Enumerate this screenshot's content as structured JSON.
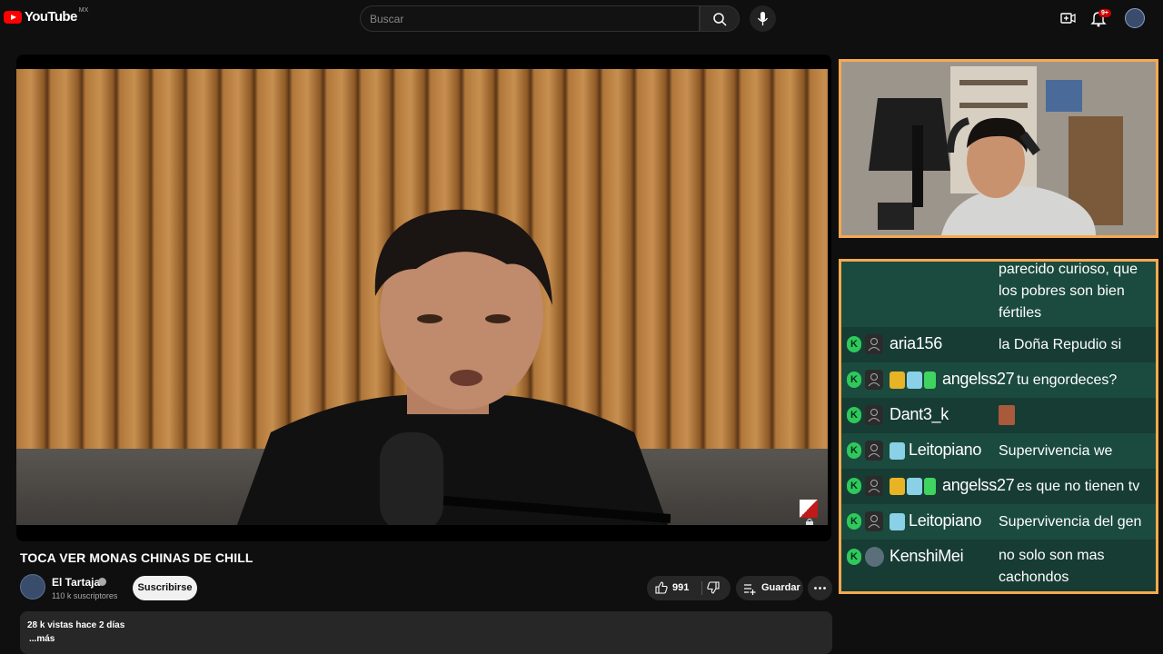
{
  "header": {
    "logo_text": "YouTube",
    "region": "MX",
    "search_placeholder": "Buscar",
    "notification_count": "9+"
  },
  "video": {
    "title": "TOCA VER MONAS CHINAS DE CHILL",
    "channel_name": "El Tartaja",
    "subscribers": "110 k suscriptores",
    "subscribe_label": "Suscribirse",
    "like_count": "991",
    "save_label": "Guardar",
    "views_date": "28 k vistas  hace 2 días",
    "more_label": "...más"
  },
  "chat": {
    "top_message": "parecido curioso, que los pobres son bien fértiles",
    "rows": [
      {
        "name": "aria156",
        "message": "la Doña Repudio si",
        "badges": []
      },
      {
        "name": "angelss27",
        "message": "tu engordeces?",
        "badges": [
          "crown",
          "avatar",
          "gift"
        ]
      },
      {
        "name": "Dant3_k",
        "message": "",
        "badges": [],
        "emote": true
      },
      {
        "name": "Leitopiano",
        "message": "Supervivencia we",
        "badges": [
          "avatar"
        ]
      },
      {
        "name": "angelss27",
        "message": "es que no tienen tv",
        "badges": [
          "crown",
          "avatar",
          "gift"
        ]
      },
      {
        "name": "Leitopiano",
        "message": "Supervivencia del gen",
        "badges": [
          "avatar"
        ]
      },
      {
        "name": "KenshiMei",
        "message": "no solo son mas cachondos",
        "badges": []
      }
    ]
  },
  "colors": {
    "overlay_border": "#f6a94e",
    "chat_bg": "#173c34",
    "chat_bg_alt": "#1b4a3e",
    "brand_red": "#ff0000"
  }
}
